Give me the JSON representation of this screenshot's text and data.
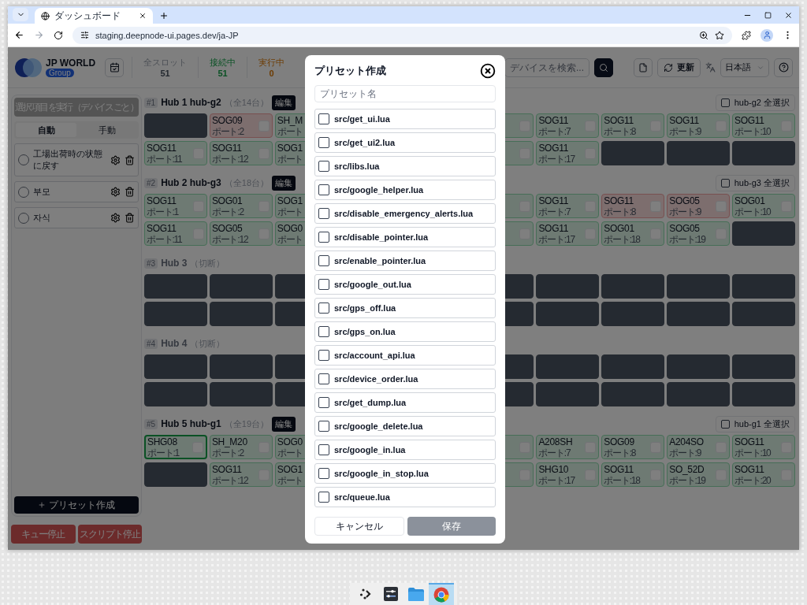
{
  "browser": {
    "tab_title": "ダッシュボード",
    "url": "staging.deepnode-ui.pages.dev/ja-JP"
  },
  "header": {
    "brand": "JP WORLD",
    "brand_badge": "Group",
    "stats": [
      {
        "label": "全スロット",
        "value": "51",
        "kind": "total"
      },
      {
        "label": "接続中",
        "value": "51",
        "kind": "connected"
      },
      {
        "label": "実行中",
        "value": "0",
        "kind": "running"
      }
    ],
    "search": {
      "placeholder": "デバイスを検索..."
    },
    "refresh_label": "更新",
    "language": "日本語"
  },
  "sidebar": {
    "run_button": "選択項目を実行（デバイスごと）",
    "modes": [
      {
        "label": "自動",
        "selected": true
      },
      {
        "label": "手動",
        "selected": false
      }
    ],
    "presets": [
      {
        "label": "工場出荷時の状態に戻す",
        "selected": false
      },
      {
        "label": "부모",
        "selected": false
      },
      {
        "label": "자식",
        "selected": false
      }
    ],
    "create_button": "プリセット作成",
    "stop_buttons": [
      "キュー停止",
      "スクリプト停止"
    ]
  },
  "hubs": [
    {
      "number": "#1",
      "title": "Hub 1 hub-g2",
      "count": "（全14台）",
      "connected": true,
      "edit": "編集",
      "select_all": {
        "label": "hub-g2 全選択",
        "checked": false
      },
      "rows": [
        {
          "left": [
            {
              "kind": "empty"
            },
            {
              "kind": "error",
              "name": "SOG09",
              "port": "ポート:2",
              "checked": false
            },
            {
              "kind": "online",
              "name": "SH_M",
              "port": "ポート"
            }
          ],
          "right": [
            {
              "kind": "online",
              "checked": false
            },
            {
              "kind": "online",
              "name": "SOG11",
              "port": "ポート:7",
              "checked": false
            },
            {
              "kind": "online",
              "name": "SOG11",
              "port": "ポート:8",
              "checked": false
            },
            {
              "kind": "online",
              "name": "SOG11",
              "port": "ポート:9",
              "checked": false
            },
            {
              "kind": "online",
              "name": "SOG11",
              "port": "ポート:10",
              "checked": false
            }
          ]
        },
        {
          "left": [
            {
              "kind": "online",
              "name": "SOG11",
              "port": "ポート:11",
              "checked": false
            },
            {
              "kind": "online",
              "name": "SOG11",
              "port": "ポート:12",
              "checked": false
            },
            {
              "kind": "online",
              "name": "SOG1",
              "port": "ポート"
            }
          ],
          "right": [
            {
              "kind": "online",
              "checked": false
            },
            {
              "kind": "online",
              "name": "SOG11",
              "port": "ポート:17",
              "checked": false
            },
            {
              "kind": "empty"
            },
            {
              "kind": "empty"
            },
            {
              "kind": "empty"
            }
          ]
        }
      ]
    },
    {
      "number": "#2",
      "title": "Hub 2 hub-g3",
      "count": "（全18台）",
      "connected": true,
      "edit": "編集",
      "select_all": {
        "label": "hub-g3 全選択",
        "checked": false
      },
      "rows": [
        {
          "left": [
            {
              "kind": "online",
              "name": "SOG11",
              "port": "ポート:1",
              "checked": false
            },
            {
              "kind": "online",
              "name": "SOG01",
              "port": "ポート:2",
              "checked": false
            },
            {
              "kind": "online",
              "name": "SOG1",
              "port": "ポート"
            }
          ],
          "right": [
            {
              "kind": "online",
              "checked": false
            },
            {
              "kind": "online",
              "name": "SOG11",
              "port": "ポート:7",
              "checked": false
            },
            {
              "kind": "error",
              "name": "SOG11",
              "port": "ポート:8",
              "checked": false
            },
            {
              "kind": "error",
              "name": "SOG05",
              "port": "ポート:9",
              "checked": false
            },
            {
              "kind": "online",
              "name": "SOG01",
              "port": "ポート:10",
              "checked": false
            }
          ]
        },
        {
          "left": [
            {
              "kind": "online",
              "name": "SOG11",
              "port": "ポート:11",
              "checked": false
            },
            {
              "kind": "online",
              "name": "SOG05",
              "port": "ポート:12",
              "checked": false
            },
            {
              "kind": "online",
              "name": "SOG0",
              "port": "ポート"
            }
          ],
          "right": [
            {
              "kind": "online",
              "checked": false
            },
            {
              "kind": "online",
              "name": "SOG11",
              "port": "ポート:17",
              "checked": false
            },
            {
              "kind": "online",
              "name": "SOG01",
              "port": "ポート:18",
              "checked": false
            },
            {
              "kind": "online",
              "name": "SOG05",
              "port": "ポート:19",
              "checked": false
            },
            {
              "kind": "empty"
            }
          ]
        }
      ]
    },
    {
      "number": "#3",
      "title": "Hub 3",
      "count": "（切断）",
      "connected": false,
      "rows": [
        {
          "left": [
            {
              "kind": "empty"
            },
            {
              "kind": "empty"
            },
            {
              "kind": "empty"
            }
          ],
          "right": [
            {
              "kind": "empty"
            },
            {
              "kind": "empty"
            },
            {
              "kind": "empty"
            },
            {
              "kind": "empty"
            },
            {
              "kind": "empty"
            }
          ]
        },
        {
          "left": [
            {
              "kind": "empty"
            },
            {
              "kind": "empty"
            },
            {
              "kind": "empty"
            }
          ],
          "right": [
            {
              "kind": "empty"
            },
            {
              "kind": "empty"
            },
            {
              "kind": "empty"
            },
            {
              "kind": "empty"
            },
            {
              "kind": "empty"
            }
          ]
        }
      ]
    },
    {
      "number": "#4",
      "title": "Hub 4",
      "count": "（切断）",
      "connected": false,
      "rows": [
        {
          "left": [
            {
              "kind": "empty"
            },
            {
              "kind": "empty"
            },
            {
              "kind": "empty"
            }
          ],
          "right": [
            {
              "kind": "empty"
            },
            {
              "kind": "empty"
            },
            {
              "kind": "empty"
            },
            {
              "kind": "empty"
            },
            {
              "kind": "empty"
            }
          ]
        },
        {
          "left": [
            {
              "kind": "empty"
            },
            {
              "kind": "empty"
            },
            {
              "kind": "empty"
            }
          ],
          "right": [
            {
              "kind": "empty"
            },
            {
              "kind": "empty"
            },
            {
              "kind": "empty"
            },
            {
              "kind": "empty"
            },
            {
              "kind": "empty"
            }
          ]
        }
      ]
    },
    {
      "number": "#5",
      "title": "Hub 5 hub-g1",
      "count": "（全19台）",
      "connected": true,
      "edit": "編集",
      "select_all": {
        "label": "hub-g1 全選択",
        "checked": false
      },
      "rows": [
        {
          "left": [
            {
              "kind": "active",
              "name": "SHG08",
              "port": "ポート:1",
              "checked": false
            },
            {
              "kind": "online",
              "name": "SH_M20",
              "port": "ポート:2",
              "checked": false
            },
            {
              "kind": "online",
              "name": "SOG0",
              "port": "ポート"
            }
          ],
          "right": [
            {
              "kind": "online",
              "checked": false
            },
            {
              "kind": "online",
              "name": "A208SH",
              "port": "ポート:7",
              "checked": false
            },
            {
              "kind": "online",
              "name": "SOG09",
              "port": "ポート:8",
              "checked": false
            },
            {
              "kind": "online",
              "name": "A204SO",
              "port": "ポート:9",
              "checked": false
            },
            {
              "kind": "online",
              "name": "SOG11",
              "port": "ポート:10",
              "checked": false
            }
          ]
        },
        {
          "left": [
            {
              "kind": "empty"
            },
            {
              "kind": "online",
              "name": "SOG11",
              "port": "ポート:12",
              "checked": false
            },
            {
              "kind": "online",
              "name": "SOG1",
              "port": "ポート"
            }
          ],
          "right": [
            {
              "kind": "online",
              "checked": false
            },
            {
              "kind": "online",
              "name": "SHG10",
              "port": "ポート:17",
              "checked": false
            },
            {
              "kind": "online",
              "name": "SOG11",
              "port": "ポート:18",
              "checked": false
            },
            {
              "kind": "online",
              "name": "SO_52D",
              "port": "ポート:19",
              "checked": false
            },
            {
              "kind": "online",
              "name": "SOG11",
              "port": "ポート:20",
              "checked": false
            }
          ]
        }
      ]
    }
  ],
  "dialog": {
    "title": "プリセット作成",
    "name_field": {
      "placeholder": "プリセット名"
    },
    "scripts": [
      {
        "label": "src/get_ui.lua",
        "checked": false
      },
      {
        "label": "src/get_ui2.lua",
        "checked": false
      },
      {
        "label": "src/libs.lua",
        "checked": false
      },
      {
        "label": "src/google_helper.lua",
        "checked": false
      },
      {
        "label": "src/disable_emergency_alerts.lua",
        "checked": false
      },
      {
        "label": "src/disable_pointer.lua",
        "checked": false
      },
      {
        "label": "src/enable_pointer.lua",
        "checked": false
      },
      {
        "label": "src/google_out.lua",
        "checked": false
      },
      {
        "label": "src/gps_off.lua",
        "checked": false
      },
      {
        "label": "src/gps_on.lua",
        "checked": false
      },
      {
        "label": "src/account_api.lua",
        "checked": false
      },
      {
        "label": "src/device_order.lua",
        "checked": false
      },
      {
        "label": "src/get_dump.lua",
        "checked": false
      },
      {
        "label": "src/google_delete.lua",
        "checked": false
      },
      {
        "label": "src/google_in.lua",
        "checked": false
      },
      {
        "label": "src/google_in_stop.lua",
        "checked": false
      },
      {
        "label": "src/queue.lua",
        "checked": false
      }
    ],
    "cancel": "キャンセル",
    "save": "保存"
  }
}
